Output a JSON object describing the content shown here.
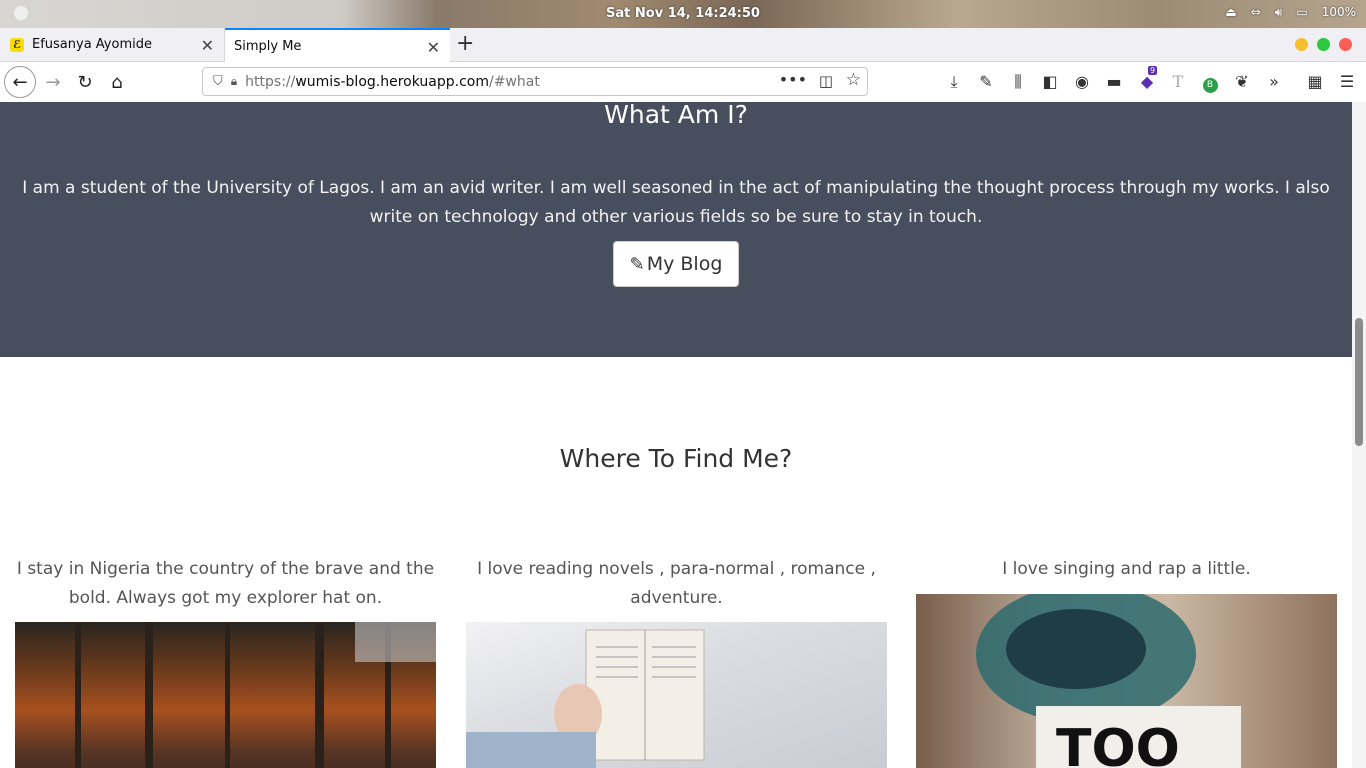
{
  "os": {
    "clock": "Sat Nov 14, 14:24:50",
    "battery": "100%"
  },
  "tabs": [
    {
      "label": "Efusanya Ayomide",
      "favicon": "ℰ"
    },
    {
      "label": "Simply Me"
    }
  ],
  "url": {
    "prefix": "https://",
    "host": "wumis-blog.herokuapp.com",
    "path": "/#what"
  },
  "extension_badge": "9",
  "what": {
    "title": "What Am I?",
    "text": "I am a student of the University of Lagos. I am an avid writer. I am well seasoned in the act of manipulating the thought process through my works. I also write on technology and other various fields so be sure to stay in touch.",
    "button": "My Blog"
  },
  "find": {
    "title": "Where To Find Me?",
    "items": [
      {
        "text": "I stay in Nigeria the country of the brave and the bold. Always got my explorer hat on.",
        "image": "autumn-forest-image"
      },
      {
        "text": "I love reading novels , para-normal , romance , adventure.",
        "image": "open-book-image"
      },
      {
        "text": "I love singing and rap a little.",
        "image": "graffiti-wall-image"
      }
    ]
  },
  "colors": {
    "section_bg": "#474e5d",
    "accent": "#0a84ff"
  }
}
